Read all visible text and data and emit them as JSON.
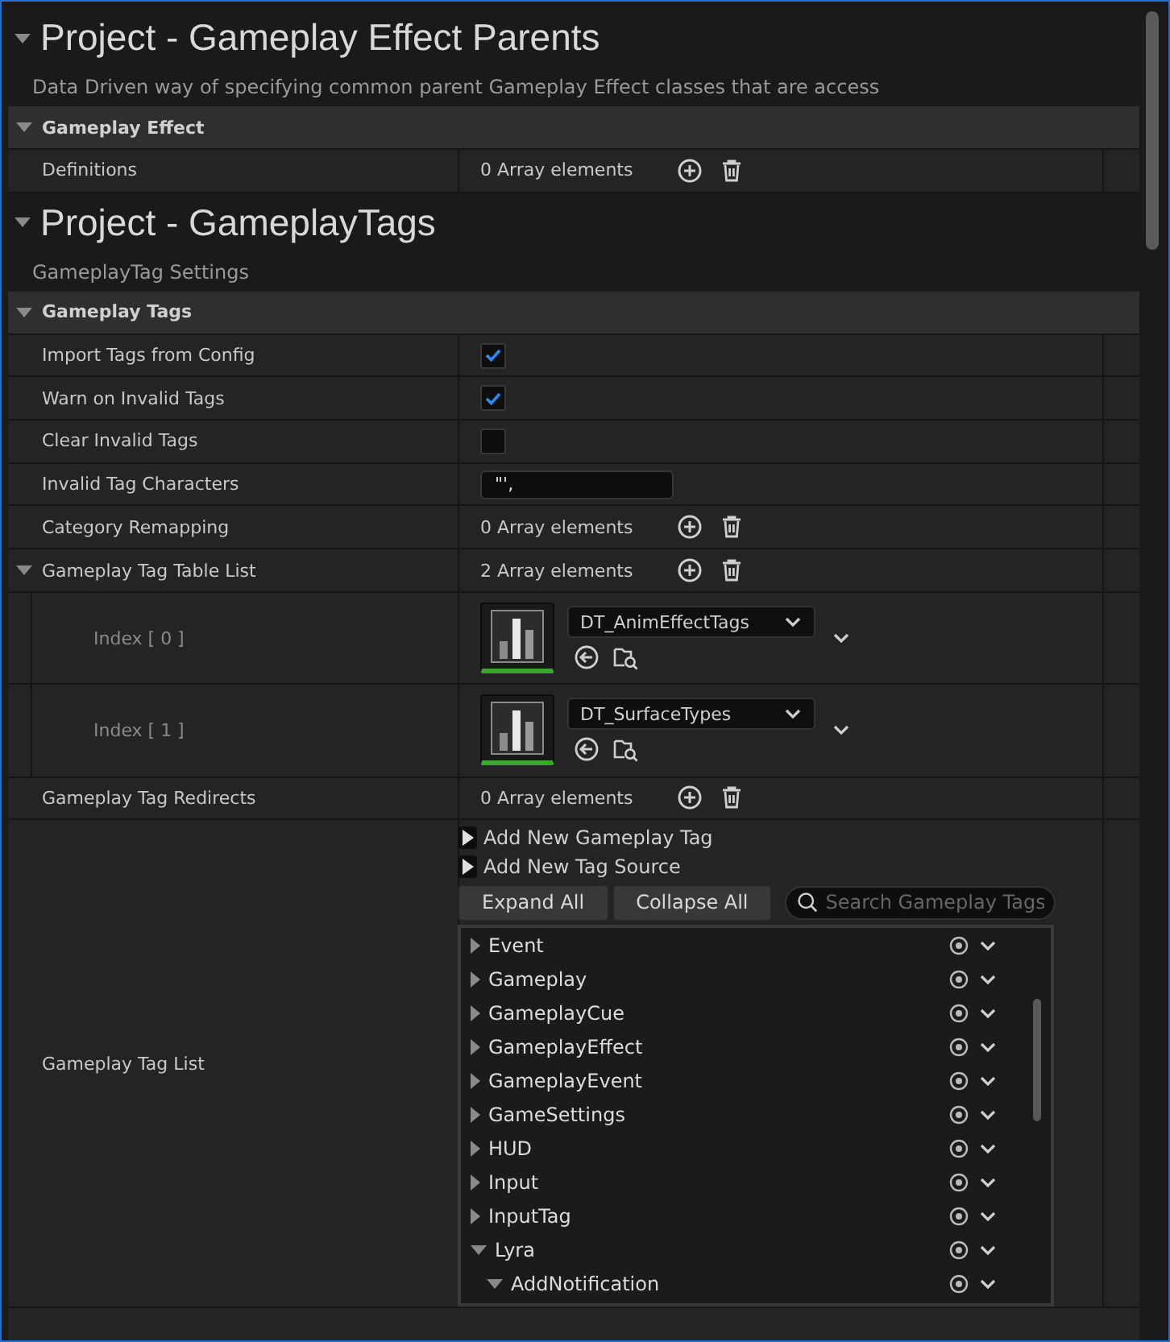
{
  "sections": [
    {
      "title": "Project - Gameplay Effect Parents",
      "expanded": true,
      "description": "Data Driven way of specifying common parent Gameplay Effect classes that are access",
      "categories": [
        {
          "name": "Gameplay Effect",
          "expanded": true,
          "properties": [
            {
              "kind": "array",
              "label": "Definitions",
              "value": "0 Array elements"
            }
          ]
        }
      ]
    },
    {
      "title": "Project - GameplayTags",
      "expanded": true,
      "description": "GameplayTag Settings",
      "categories": [
        {
          "name": "Gameplay Tags",
          "expanded": true,
          "properties": [
            {
              "kind": "checkbox",
              "label": "Import Tags from Config",
              "checked": true
            },
            {
              "kind": "checkbox",
              "label": "Warn on Invalid Tags",
              "checked": true
            },
            {
              "kind": "checkbox",
              "label": "Clear Invalid Tags",
              "checked": false
            },
            {
              "kind": "text",
              "label": "Invalid Tag Characters",
              "value": "\"',"
            },
            {
              "kind": "array",
              "label": "Category Remapping",
              "value": "0 Array elements"
            },
            {
              "kind": "array",
              "label": "Gameplay Tag Table List",
              "value": "2 Array elements",
              "expanded": true,
              "elements": [
                {
                  "label": "Index [ 0 ]",
                  "asset": "DT_AnimEffectTags"
                },
                {
                  "label": "Index [ 1 ]",
                  "asset": "DT_SurfaceTypes"
                }
              ]
            },
            {
              "kind": "array",
              "label": "Gameplay Tag Redirects",
              "value": "0 Array elements"
            },
            {
              "kind": "tag_list",
              "label": "Gameplay Tag List",
              "actions": [
                "Add New Gameplay Tag",
                "Add New Tag Source"
              ],
              "buttons": [
                "Expand All",
                "Collapse All"
              ],
              "search_placeholder": "Search Gameplay Tags",
              "tags": [
                {
                  "name": "Event",
                  "expanded": false
                },
                {
                  "name": "Gameplay",
                  "expanded": false
                },
                {
                  "name": "GameplayCue",
                  "expanded": false
                },
                {
                  "name": "GameplayEffect",
                  "expanded": false
                },
                {
                  "name": "GameplayEvent",
                  "expanded": false
                },
                {
                  "name": "GameSettings",
                  "expanded": false
                },
                {
                  "name": "HUD",
                  "expanded": false
                },
                {
                  "name": "Input",
                  "expanded": false
                },
                {
                  "name": "InputTag",
                  "expanded": false
                },
                {
                  "name": "Lyra",
                  "expanded": true,
                  "children": [
                    {
                      "name": "AddNotification",
                      "expanded": true
                    }
                  ]
                }
              ]
            }
          ]
        }
      ]
    }
  ]
}
